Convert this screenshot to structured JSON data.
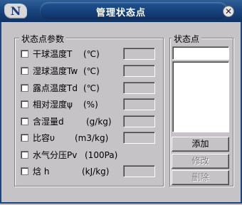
{
  "window": {
    "title": "管理状态点",
    "logo_glyph": "N",
    "close_glyph": "✕"
  },
  "params": {
    "group_title": "状态点参数",
    "rows": [
      {
        "label": "干球温度T",
        "unit": "(℃)"
      },
      {
        "label": "湿球温度Tw",
        "unit": "(℃)"
      },
      {
        "label": "露点温度Td",
        "unit": "(℃)"
      },
      {
        "label": "相对湿度ψ",
        "unit": "(%)"
      },
      {
        "label": "含湿量d",
        "unit": "(g/kg)"
      },
      {
        "label": "比容υ",
        "unit": "(m3/kg)"
      },
      {
        "label": "水气分压Pv",
        "unit": "(100Pa)"
      },
      {
        "label": "焓 h",
        "unit": "(kJ/kg)"
      }
    ]
  },
  "points": {
    "group_title": "状态点",
    "add_label": "添加",
    "modify_label": "修改",
    "delete_label": "删除"
  },
  "colors": {
    "title_bar": "#1a4680",
    "dialog_bg": "#c6c3c6"
  }
}
